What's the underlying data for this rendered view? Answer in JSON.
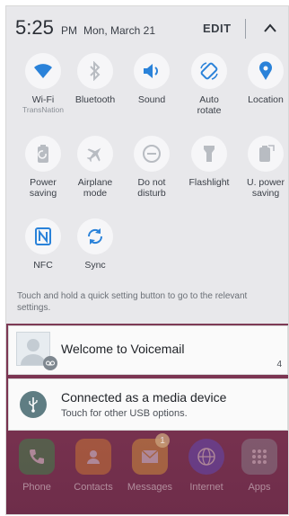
{
  "header": {
    "time": "5:25",
    "ampm": "PM",
    "date": "Mon, March 21",
    "edit_label": "EDIT"
  },
  "quick_settings": [
    {
      "label": "Wi-Fi",
      "sub": "TransNation",
      "icon": "wifi-icon",
      "state": "on"
    },
    {
      "label": "Bluetooth",
      "icon": "bluetooth-icon",
      "state": "off"
    },
    {
      "label": "Sound",
      "icon": "sound-icon",
      "state": "on"
    },
    {
      "label_line1": "Auto",
      "label_line2": "rotate",
      "icon": "auto-rotate-icon",
      "state": "on"
    },
    {
      "label": "Location",
      "icon": "location-icon",
      "state": "on"
    },
    {
      "label_line1": "Power",
      "label_line2": "saving",
      "icon": "power-saving-icon",
      "state": "off"
    },
    {
      "label_line1": "Airplane",
      "label_line2": "mode",
      "icon": "airplane-icon",
      "state": "off"
    },
    {
      "label_line1": "Do not",
      "label_line2": "disturb",
      "icon": "do-not-disturb-icon",
      "state": "off"
    },
    {
      "label": "Flashlight",
      "icon": "flashlight-icon",
      "state": "off"
    },
    {
      "label_line1": "U. power",
      "label_line2": "saving",
      "icon": "ultra-power-saving-icon",
      "state": "off"
    },
    {
      "label": "NFC",
      "icon": "nfc-icon",
      "state": "on"
    },
    {
      "label": "Sync",
      "icon": "sync-icon",
      "state": "on"
    }
  ],
  "hint": "Touch and hold a quick setting button to go to the relevant settings.",
  "notifications": [
    {
      "title": "Welcome to Voicemail",
      "count": "4",
      "icon": "voicemail-icon"
    },
    {
      "title": "Connected as a media device",
      "subtitle": "Touch for other USB options.",
      "icon": "usb-icon"
    }
  ],
  "dock": [
    {
      "label": "Phone",
      "icon": "phone-icon",
      "color": "#2e9b4a"
    },
    {
      "label": "Contacts",
      "icon": "contacts-icon",
      "color": "#e08a2e"
    },
    {
      "label": "Messages",
      "icon": "messages-icon",
      "color": "#e8a836",
      "badge": "1"
    },
    {
      "label": "Internet",
      "icon": "internet-icon",
      "color": "#5b4fd1"
    },
    {
      "label": "Apps",
      "icon": "apps-grid-icon",
      "color": "#8f8f98"
    }
  ],
  "colors": {
    "accent": "#2a82d9",
    "inactive": "#b8bcc2"
  }
}
